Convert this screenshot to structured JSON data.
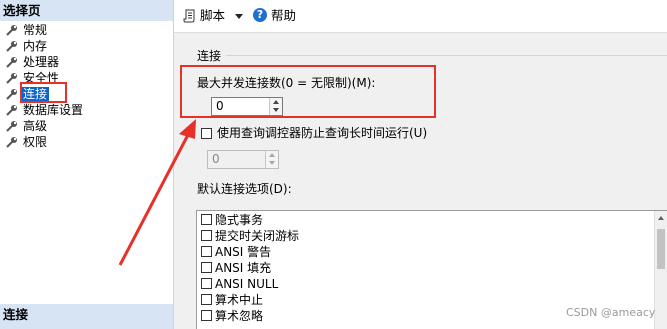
{
  "left_pane": {
    "header": "选择页",
    "items": [
      {
        "label": "常规",
        "selected": false
      },
      {
        "label": "内存",
        "selected": false
      },
      {
        "label": "处理器",
        "selected": false
      },
      {
        "label": "安全性",
        "selected": false
      },
      {
        "label": "连接",
        "selected": true
      },
      {
        "label": "数据库设置",
        "selected": false
      },
      {
        "label": "高级",
        "selected": false
      },
      {
        "label": "权限",
        "selected": false
      }
    ],
    "footer": "连接",
    "icon": "wrench-icon"
  },
  "toolbar": {
    "script_label": "脚本",
    "help_label": "帮助",
    "help_icon_glyph": "?"
  },
  "connection": {
    "group_title": "连接",
    "max_connections_label": "最大并发连接数(0 = 无限制)(M):",
    "max_connections_value": "0",
    "query_governor_label": "使用查询调控器防止查询长时间运行(U)",
    "query_governor_checked": false,
    "query_governor_value": "0",
    "default_options_label": "默认连接选项(D):",
    "default_options": [
      {
        "label": "隐式事务",
        "checked": false
      },
      {
        "label": "提交时关闭游标",
        "checked": false
      },
      {
        "label": "ANSI 警告",
        "checked": false
      },
      {
        "label": "ANSI 填充",
        "checked": false
      },
      {
        "label": "ANSI NULL",
        "checked": false
      },
      {
        "label": "算术中止",
        "checked": false
      },
      {
        "label": "算术忽略",
        "checked": false
      }
    ]
  },
  "watermark": "CSDN @ameacy",
  "colors": {
    "selection": "#0a64d2",
    "highlight": "#e8302a",
    "header_bg": "#d6e4f4",
    "help_icon": "#1e6fd0"
  }
}
